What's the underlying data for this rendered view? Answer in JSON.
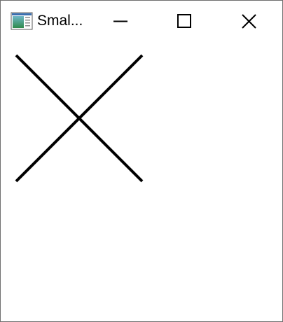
{
  "window": {
    "title": "Smal..."
  },
  "titlebar": {
    "icon": "app-window-icon",
    "minimize_icon": "minimize-icon",
    "maximize_icon": "maximize-icon",
    "close_icon": "close-icon"
  },
  "canvas": {
    "shape": "x-cross",
    "stroke_color": "#000000",
    "background_color": "#ffffff"
  }
}
